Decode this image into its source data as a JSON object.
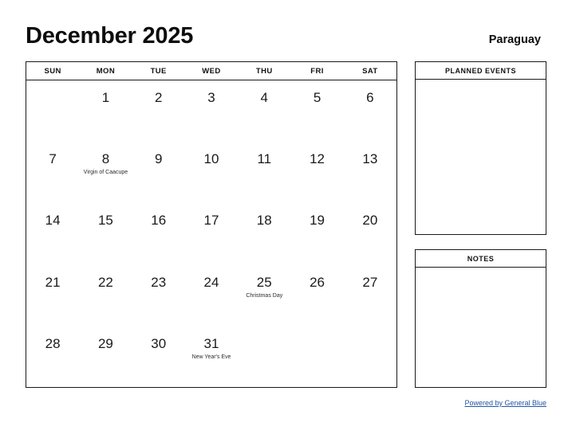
{
  "header": {
    "month_title": "December 2025",
    "country": "Paraguay"
  },
  "calendar": {
    "weekday_headers": [
      "SUN",
      "MON",
      "TUE",
      "WED",
      "THU",
      "FRI",
      "SAT"
    ],
    "weeks": [
      [
        {
          "day": "",
          "event": ""
        },
        {
          "day": "1",
          "event": ""
        },
        {
          "day": "2",
          "event": ""
        },
        {
          "day": "3",
          "event": ""
        },
        {
          "day": "4",
          "event": ""
        },
        {
          "day": "5",
          "event": ""
        },
        {
          "day": "6",
          "event": ""
        }
      ],
      [
        {
          "day": "7",
          "event": ""
        },
        {
          "day": "8",
          "event": "Virgin of Caacupe"
        },
        {
          "day": "9",
          "event": ""
        },
        {
          "day": "10",
          "event": ""
        },
        {
          "day": "11",
          "event": ""
        },
        {
          "day": "12",
          "event": ""
        },
        {
          "day": "13",
          "event": ""
        }
      ],
      [
        {
          "day": "14",
          "event": ""
        },
        {
          "day": "15",
          "event": ""
        },
        {
          "day": "16",
          "event": ""
        },
        {
          "day": "17",
          "event": ""
        },
        {
          "day": "18",
          "event": ""
        },
        {
          "day": "19",
          "event": ""
        },
        {
          "day": "20",
          "event": ""
        }
      ],
      [
        {
          "day": "21",
          "event": ""
        },
        {
          "day": "22",
          "event": ""
        },
        {
          "day": "23",
          "event": ""
        },
        {
          "day": "24",
          "event": ""
        },
        {
          "day": "25",
          "event": "Christmas Day"
        },
        {
          "day": "26",
          "event": ""
        },
        {
          "day": "27",
          "event": ""
        }
      ],
      [
        {
          "day": "28",
          "event": ""
        },
        {
          "day": "29",
          "event": ""
        },
        {
          "day": "30",
          "event": ""
        },
        {
          "day": "31",
          "event": "New Year's Eve"
        },
        {
          "day": "",
          "event": ""
        },
        {
          "day": "",
          "event": ""
        },
        {
          "day": "",
          "event": ""
        }
      ]
    ]
  },
  "panels": {
    "planned_events": {
      "title": "PLANNED EVENTS",
      "content": ""
    },
    "notes": {
      "title": "NOTES",
      "content": ""
    }
  },
  "footer": {
    "link_text": "Powered by General Blue",
    "link_color": "#2255a4"
  }
}
